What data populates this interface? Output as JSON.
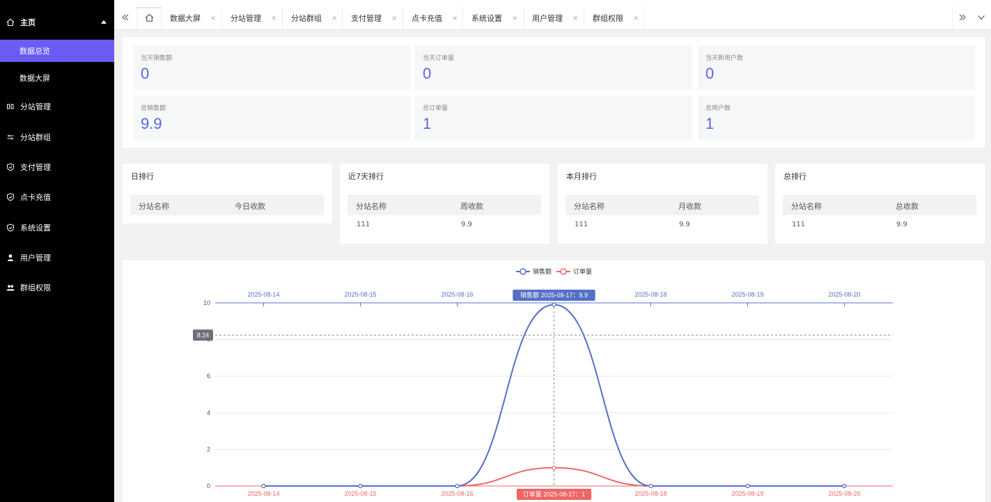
{
  "sidebar": {
    "items": [
      {
        "label": "主页",
        "icon": "home-icon"
      },
      {
        "label": "数据总览",
        "icon": ""
      },
      {
        "label": "数据大屏",
        "icon": ""
      },
      {
        "label": "分站管理",
        "icon": "columns-icon"
      },
      {
        "label": "分站群组",
        "icon": "sliders-icon"
      },
      {
        "label": "支付管理",
        "icon": "shield-icon"
      },
      {
        "label": "点卡充值",
        "icon": "shield-icon"
      },
      {
        "label": "系统设置",
        "icon": "shield-icon"
      },
      {
        "label": "用户管理",
        "icon": "user-icon"
      },
      {
        "label": "群组权限",
        "icon": "users-icon"
      }
    ],
    "active_color": "#6a5cf5"
  },
  "tabs": [
    {
      "label": "数据大屏"
    },
    {
      "label": "分站管理"
    },
    {
      "label": "分站群组"
    },
    {
      "label": "支付管理"
    },
    {
      "label": "点卡充值"
    },
    {
      "label": "系统设置"
    },
    {
      "label": "用户管理"
    },
    {
      "label": "群组权限"
    }
  ],
  "tab_close": "×",
  "stats": [
    {
      "label": "当天销售额",
      "value": "0"
    },
    {
      "label": "当天订单量",
      "value": "0"
    },
    {
      "label": "当天新用户数",
      "value": "0"
    },
    {
      "label": "总销售额",
      "value": "9.9"
    },
    {
      "label": "总订单量",
      "value": "1"
    },
    {
      "label": "总用户数",
      "value": "1"
    }
  ],
  "rankings": [
    {
      "title": "日排行",
      "col1": "分站名称",
      "col2": "今日收款",
      "rows": []
    },
    {
      "title": "近7天排行",
      "col1": "分站名称",
      "col2": "周收款",
      "rows": [
        {
          "name": "111",
          "amount": "9.9"
        }
      ]
    },
    {
      "title": "本月排行",
      "col1": "分站名称",
      "col2": "月收款",
      "rows": [
        {
          "name": "111",
          "amount": "9.9"
        }
      ]
    },
    {
      "title": "总排行",
      "col1": "分站名称",
      "col2": "总收款",
      "rows": [
        {
          "name": "111",
          "amount": "9.9"
        }
      ]
    }
  ],
  "chart_data": {
    "type": "line",
    "x": [
      "2025-08-14",
      "2025-08-15",
      "2025-08-16",
      "2025-08-17",
      "2025-08-18",
      "2025-08-19",
      "2025-08-20"
    ],
    "series": [
      {
        "name": "销售额",
        "values": [
          0,
          0,
          0,
          9.9,
          0,
          0,
          0
        ],
        "color": "#5470c6"
      },
      {
        "name": "订单量",
        "values": [
          0,
          0,
          0,
          1,
          0,
          0,
          0
        ],
        "color": "#ee6666"
      }
    ],
    "ylim": [
      0,
      10
    ],
    "yticks": [
      0,
      2,
      4,
      6,
      8,
      10
    ],
    "smooth": true,
    "legend": "top-center",
    "grid": true,
    "pointer": {
      "y_label": "8.24",
      "sales_label": "销售额  2025-08-17：9.9",
      "orders_label": "订单量  2025-08-17：1"
    }
  }
}
